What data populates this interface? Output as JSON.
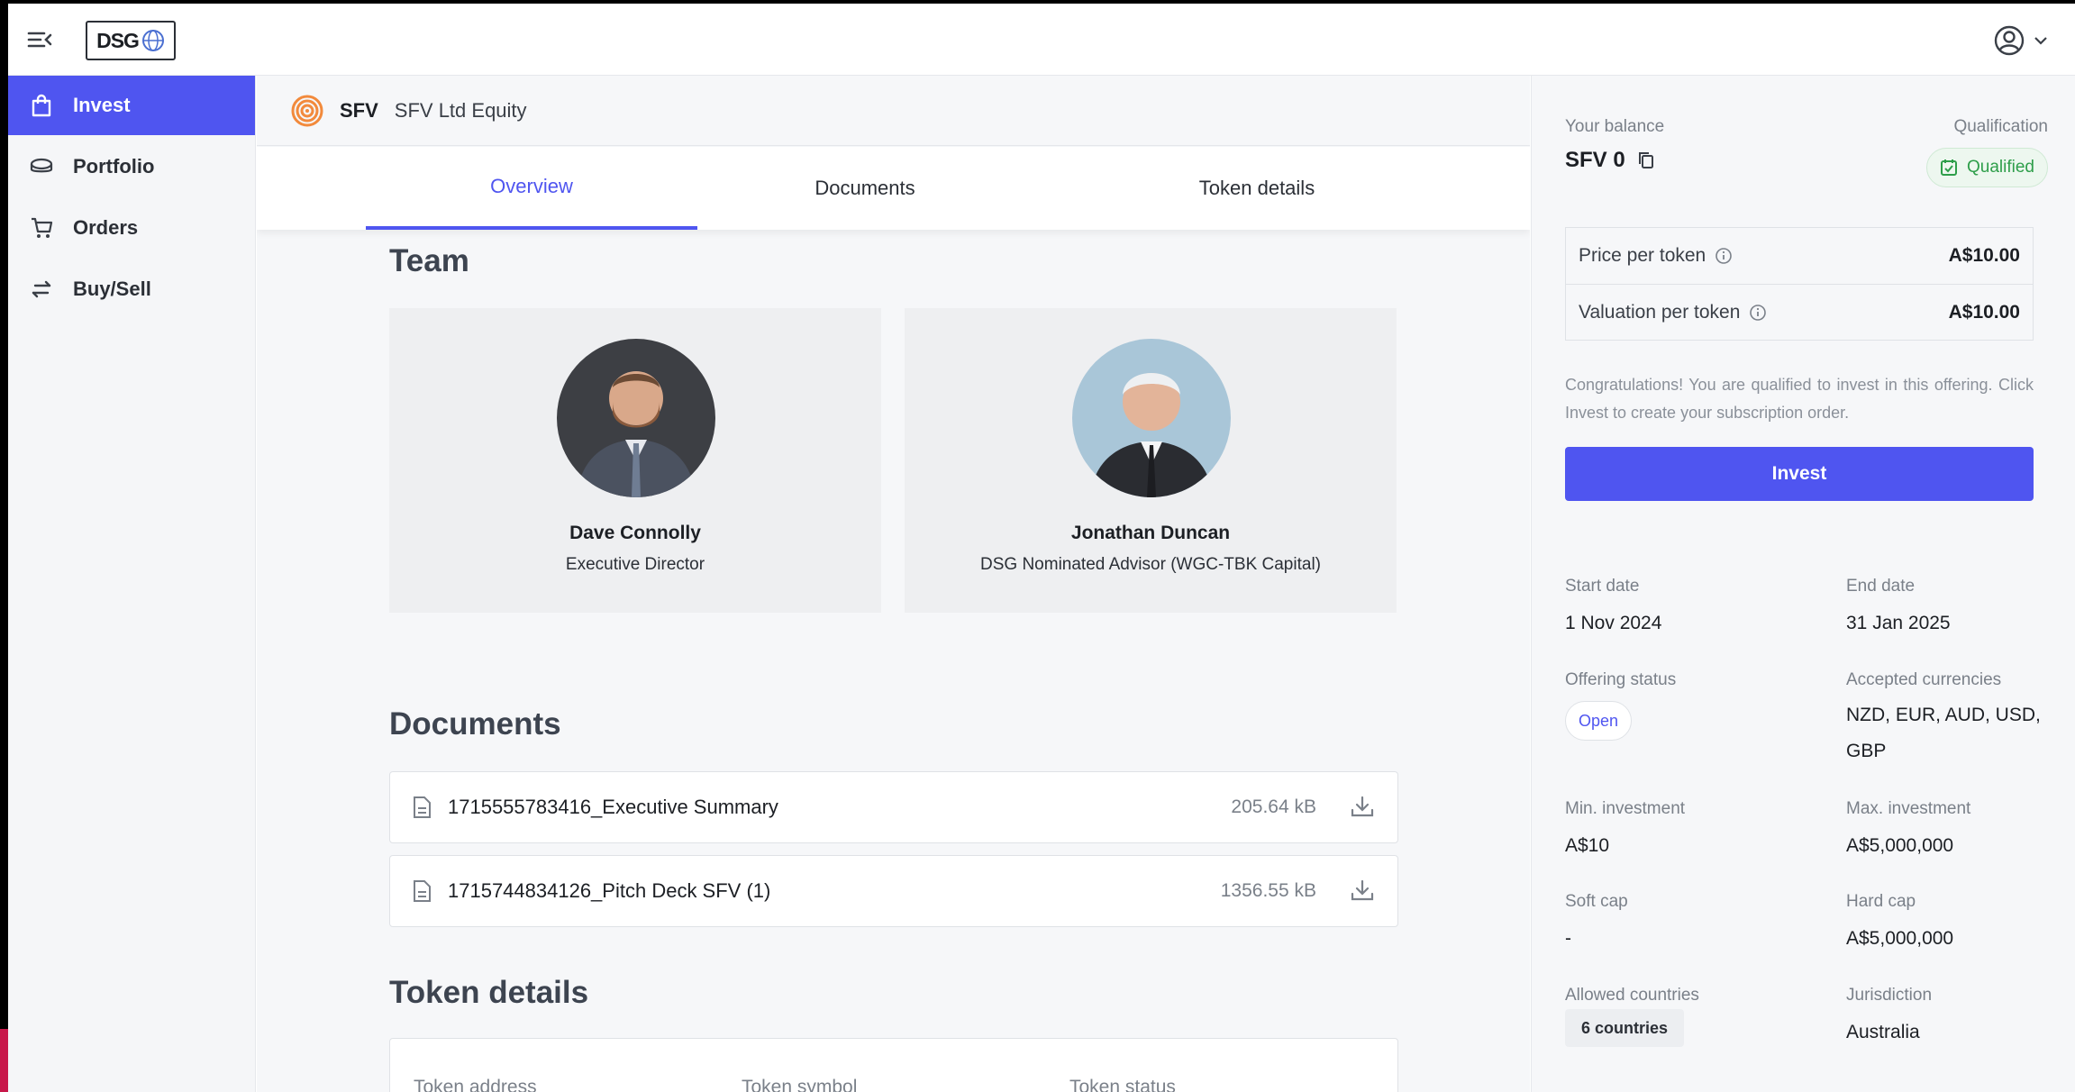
{
  "app": {
    "logo_text": "DSG"
  },
  "sidebar": {
    "items": [
      {
        "label": "Invest",
        "icon": "shopping-bag-icon"
      },
      {
        "label": "Portfolio",
        "icon": "coins-icon"
      },
      {
        "label": "Orders",
        "icon": "cart-icon"
      },
      {
        "label": "Buy/Sell",
        "icon": "swap-icon"
      }
    ]
  },
  "offering": {
    "symbol": "SFV",
    "name": "SFV Ltd Equity"
  },
  "tabs": [
    "Overview",
    "Documents",
    "Token details"
  ],
  "team": {
    "title": "Team",
    "members": [
      {
        "name": "Dave Connolly",
        "role": "Executive Director"
      },
      {
        "name": "Jonathan Duncan",
        "role": "DSG Nominated Advisor (WGC-TBK Capital)"
      }
    ]
  },
  "documents": {
    "title": "Documents",
    "items": [
      {
        "name": "1715555783416_Executive Summary",
        "size": "205.64 kB"
      },
      {
        "name": "1715744834126_Pitch Deck SFV (1)",
        "size": "1356.55 kB"
      }
    ]
  },
  "token_details": {
    "title": "Token details",
    "labels": [
      "Token address",
      "Token symbol",
      "Token status"
    ]
  },
  "panel": {
    "balance_label": "Your balance",
    "balance_value": "SFV 0",
    "qualification_label": "Qualification",
    "qualification_value": "Qualified",
    "price_label": "Price per token",
    "price_value": "A$10.00",
    "valuation_label": "Valuation per token",
    "valuation_value": "A$10.00",
    "congrats": "Congratulations! You are qualified to invest in this offering. Click Invest to create your subscription order.",
    "invest_label": "Invest",
    "start_label": "Start date",
    "start_value": "1 Nov 2024",
    "end_label": "End date",
    "end_value": "31 Jan 2025",
    "status_label": "Offering status",
    "status_value": "Open",
    "currencies_label": "Accepted currencies",
    "currencies_line1": "NZD, EUR, AUD, USD,",
    "currencies_line2": "GBP",
    "min_label": "Min. investment",
    "min_value": "A$10",
    "max_label": "Max. investment",
    "max_value": "A$5,000,000",
    "softcap_label": "Soft cap",
    "softcap_value": "-",
    "hardcap_label": "Hard cap",
    "hardcap_value": "A$5,000,000",
    "countries_label": "Allowed countries",
    "countries_value": "6 countries",
    "jurisdiction_label": "Jurisdiction",
    "jurisdiction_value": "Australia"
  },
  "colors": {
    "accent": "#4f55f0",
    "qualified": "#2e9e4a"
  }
}
